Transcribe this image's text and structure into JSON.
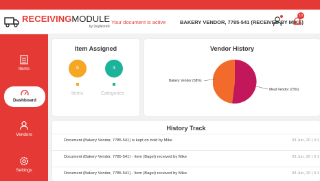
{
  "header": {
    "logo_brand_bold": "RECEIVING",
    "logo_brand_rest": "MODULE",
    "logo_by": "by DoyMork®",
    "status_message": "Your document is active",
    "vendor_title": "BAKERY VENDOR, 7785-541 (RECEIVED BY MIKE)",
    "notification_count": "10"
  },
  "sidebar": {
    "items": [
      {
        "label": "Items",
        "icon": "items-icon"
      },
      {
        "label": "Dashboard",
        "icon": "gauge-icon",
        "active": true
      },
      {
        "label": "Vendors",
        "icon": "vendors-icon"
      },
      {
        "label": "Settings",
        "icon": "gear-icon"
      }
    ]
  },
  "item_assigned": {
    "title": "Item Assigned",
    "items_count": "6",
    "items_label": "Items",
    "items_color": "#f5a623",
    "categories_count": "3",
    "categories_label": "Categories",
    "categories_color": "#1bb39a"
  },
  "vendor_history": {
    "title": "Vendor History",
    "chart_data": {
      "type": "pie",
      "slices": [
        {
          "label": "Bakery Vendor (58%)",
          "color": "#f26b2a"
        },
        {
          "label": "Meat Vendor (73%)",
          "color": "#c2185b"
        }
      ]
    }
  },
  "history_track": {
    "title": "History Track",
    "rows": [
      {
        "text": "Document (Bakery Vendor, 7785-541) is kept on hold by Mike",
        "date": "03 Jun, 20 | 3:1"
      },
      {
        "text": "Document (Bakery Vendor, 7785-541) - Item (Bagel) received by Mike",
        "date": "03 Jun, 20 | 3:1"
      },
      {
        "text": "Document (Bakery Vendor, 7785-541) - Item (Bagel) received by Mike",
        "date": "03 Jun, 20 | 3:1"
      }
    ]
  }
}
